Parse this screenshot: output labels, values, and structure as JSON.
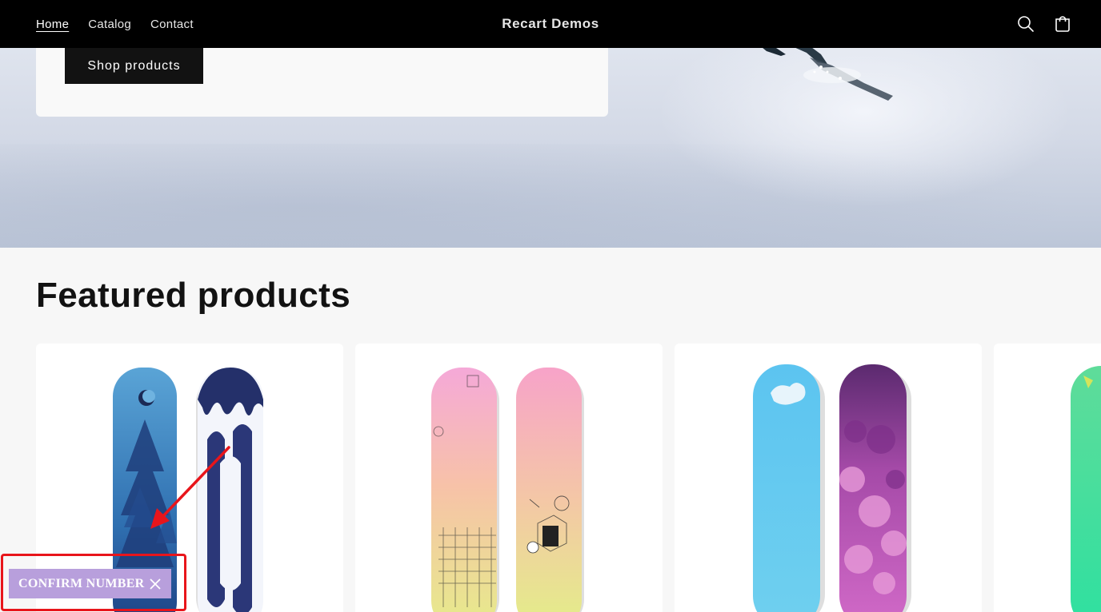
{
  "header": {
    "nav": [
      {
        "label": "Home",
        "active": true
      },
      {
        "label": "Catalog",
        "active": false
      },
      {
        "label": "Contact",
        "active": false
      }
    ],
    "brand": "Recart Demos",
    "icons": [
      "search-icon",
      "cart-icon"
    ]
  },
  "hero": {
    "button_label": "Shop products"
  },
  "featured": {
    "title": "Featured products",
    "products": [
      {
        "name": "blue-forest-snowboard-pair"
      },
      {
        "name": "pastel-pattern-snowboard-pair"
      },
      {
        "name": "cyan-purple-snowboard-pair"
      },
      {
        "name": "green-snowboard"
      }
    ]
  },
  "popup": {
    "label": "CONFIRM NUMBER",
    "close_icon": "close-icon",
    "accent": "#b89fdc",
    "highlight_color": "#e8151b"
  }
}
